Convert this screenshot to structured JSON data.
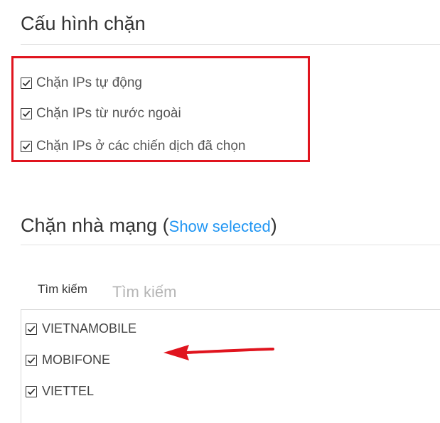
{
  "block_config": {
    "title": "Cấu hình chặn",
    "options": [
      {
        "label": "Chặn IPs tự động",
        "checked": true
      },
      {
        "label": "Chặn IPs từ nước ngoài",
        "checked": true
      },
      {
        "label": "Chặn IPs ở các chiến dịch đã chọn",
        "checked": true
      }
    ]
  },
  "carrier_block": {
    "title_prefix": "Chặn nhà mạng (",
    "show_selected_link": "Show selected",
    "title_suffix": ")",
    "search_label": "Tìm kiếm",
    "search_placeholder": "Tìm kiếm",
    "search_value": "",
    "carriers": [
      {
        "label": "VIETNAMOBILE",
        "checked": true
      },
      {
        "label": "MOBIFONE",
        "checked": true
      },
      {
        "label": "VIETTEL",
        "checked": true
      }
    ]
  },
  "colors": {
    "highlight": "#e0141e",
    "link": "#2196f3",
    "arrow": "#e0141e"
  }
}
